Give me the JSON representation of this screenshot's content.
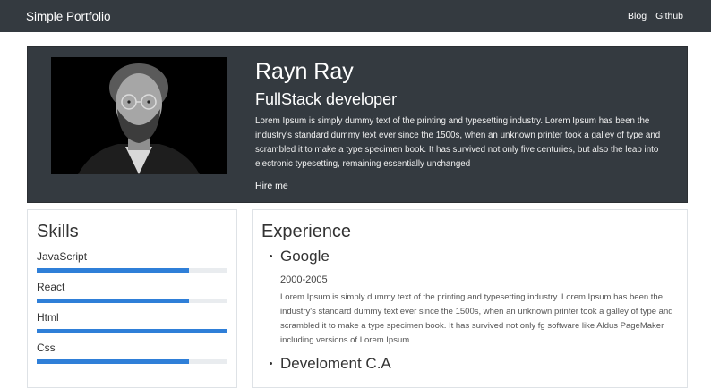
{
  "navbar": {
    "brand": "Simple Portfolio",
    "links": [
      "Blog",
      "Github"
    ]
  },
  "hero": {
    "photo": "portrait-photo",
    "name": "Rayn Ray",
    "role": "FullStack developer",
    "bio": "Lorem Ipsum is simply dummy text of the printing and typesetting industry. Lorem Ipsum has been the industry's standard dummy text ever since the 1500s, when an unknown printer took a galley of type and scrambled it to make a type specimen book. It has survived not only five centuries, but also the leap into electronic typesetting, remaining essentially unchanged",
    "cta": "Hire me"
  },
  "skills": {
    "title": "Skills",
    "accent": "#2f7fd8",
    "items": [
      {
        "name": "JavaScript",
        "level": 0.8
      },
      {
        "name": "React",
        "level": 0.8
      },
      {
        "name": "Html",
        "level": 1.0
      },
      {
        "name": "Css",
        "level": 0.8
      }
    ]
  },
  "experience": {
    "title": "Experience",
    "jobs": [
      {
        "company": "Google",
        "years": "2000-2005",
        "description": "Lorem Ipsum is simply dummy text of the printing and typesetting industry. Lorem Ipsum has been the industry's standard dummy text ever since the 1500s, when an unknown printer took a galley of type and scrambled it to make a type specimen book. It has survived not only fg software like Aldus PageMaker including versions of Lorem Ipsum."
      },
      {
        "company": "Develoment C.A"
      }
    ]
  }
}
